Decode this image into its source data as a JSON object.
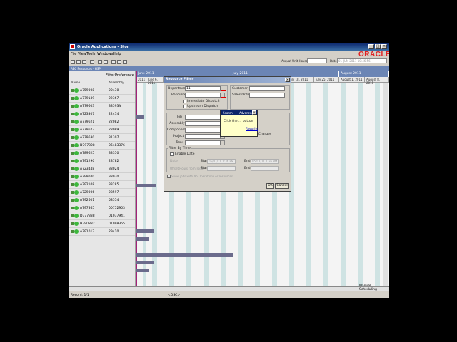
{
  "window": {
    "title": "Oracle Applications - Stor",
    "menu": [
      "File",
      "View",
      "Tools",
      "Windows",
      "Help"
    ],
    "logo": "ORACLE",
    "unit_label": "Asquat Unit Hours",
    "date_label": "Date",
    "date_value": "01-JUN-2011 10:46:56",
    "subtitle": "ABC Resources - HSP"
  },
  "left_pane": {
    "filter_label": "Filter",
    "preference_label": "Preference",
    "col_name": "Name",
    "col_assembly": "Assembly",
    "rows": [
      {
        "name": "A759008",
        "qty": "20430"
      },
      {
        "name": "A779139",
        "qty": "22367"
      },
      {
        "name": "A779603",
        "qty": "38593N"
      },
      {
        "name": "A723307",
        "qty": "22474"
      },
      {
        "name": "A779621",
        "qty": "22082"
      },
      {
        "name": "A779627",
        "qty": "28089"
      },
      {
        "name": "A779630",
        "qty": "31307"
      },
      {
        "name": "D797808",
        "qty": "06483376"
      },
      {
        "name": "A789625",
        "qty": "33350"
      },
      {
        "name": "A791290",
        "qty": "28782"
      },
      {
        "name": "A723448",
        "qty": "38024"
      },
      {
        "name": "A799040",
        "qty": "38030"
      },
      {
        "name": "A792108",
        "qty": "33285"
      },
      {
        "name": "A729006",
        "qty": "28597"
      },
      {
        "name": "A792601",
        "qty": "58554"
      },
      {
        "name": "A797865",
        "qty": "00752953"
      },
      {
        "name": "D777338",
        "qty": "01037941"
      },
      {
        "name": "H790882",
        "qty": "01098365"
      },
      {
        "name": "A791017",
        "qty": "29410"
      }
    ]
  },
  "gantt": {
    "months": [
      "June 2011",
      "July 2011",
      "August 2011"
    ],
    "days": [
      "2011",
      "June 6, 2011",
      "July 18, 2011",
      "July 25, 2011",
      "August 1, 2011",
      "August 8, 2011"
    ]
  },
  "dialog": {
    "title": "Resource Filter",
    "department_label": "Department",
    "department_value": "11",
    "resource_label": "Resource",
    "customer_label": "Customer",
    "sales_order_label": "Sales Order",
    "immediate_dispatch": "Immediate Dispatch",
    "upstream_dispatch": "Upstream Dispatch",
    "job_label": "Job",
    "assembly_label": "Assembly",
    "component_label": "Component",
    "project_label": "Project",
    "task_label": "Task",
    "complete_no_charges": "Complete - No Charges",
    "filter_by_time": "Filter By Time",
    "enable_date": "Enable Date",
    "date_label": "Date",
    "offset_label": "Offset Hours from Today",
    "start_label": "Start",
    "end_label": "End",
    "start_value": "05/07/11 1:36 PM",
    "end_value": "05/07/11 1:36 PM",
    "show_jobs": "Show jobs with No Operations or resources",
    "ok_label": "OK",
    "cancel_label": "Cancel"
  },
  "popup": {
    "header": "Search",
    "header_link": "Advanced",
    "text": "Click the ... button",
    "link": "Favorite"
  },
  "statusbar": {
    "record": "Record: 1/1",
    "osc": "<OSC>",
    "mode": "Manual Scheduling"
  }
}
